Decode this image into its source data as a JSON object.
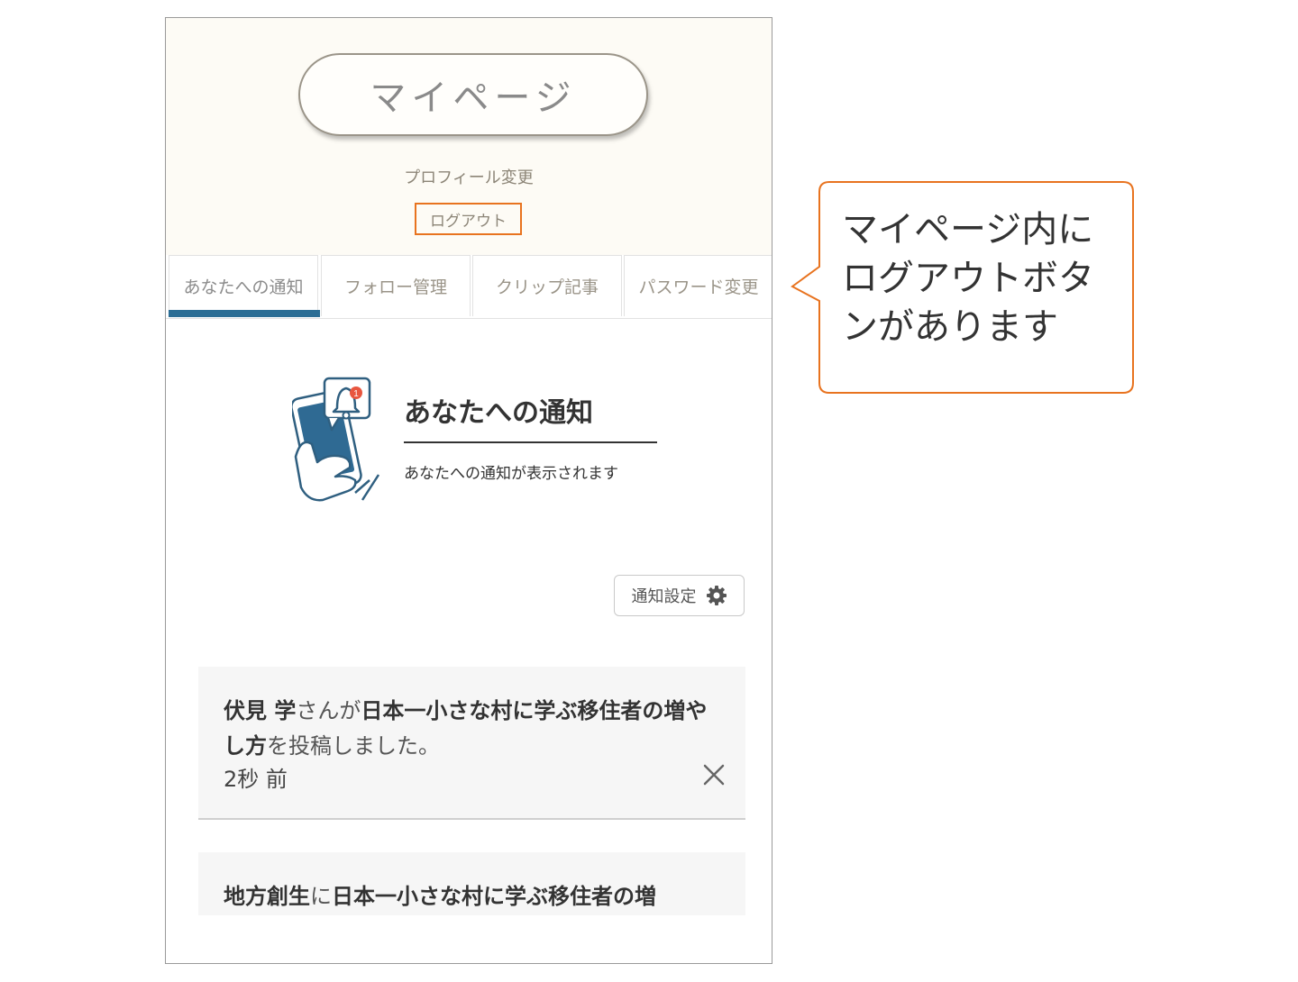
{
  "header": {
    "title": "マイページ",
    "profile_link": "プロフィール変更",
    "logout_link": "ログアウト"
  },
  "tabs": [
    {
      "label": "あなたへの通知",
      "active": true
    },
    {
      "label": "フォロー管理"
    },
    {
      "label": "クリップ記事"
    },
    {
      "label": "パスワード変更"
    }
  ],
  "notice": {
    "title": "あなたへの通知",
    "subtitle": "あなたへの通知が表示されます",
    "badge_count": "1"
  },
  "settings_button": {
    "label": "通知設定",
    "icon": "gear-icon"
  },
  "notifications": [
    {
      "user": "伏見 学",
      "verb": "さんが",
      "article": "日本一小さな村に学ぶ移住者の増やし方",
      "suffix": "を投稿しました。",
      "time": "2秒 前"
    },
    {
      "user": "地方創生",
      "verb": "に",
      "article": "日本一小さな村に学ぶ移住者の増"
    }
  ],
  "callout": {
    "line1": "マイページ内に",
    "line2": "ログアウトボタ",
    "line3": "ンがあります"
  },
  "colors": {
    "accent": "#e8731f",
    "tab_underline": "#2c6e95",
    "header_bg": "#fdfbf5",
    "phone_blue": "#2f6a93"
  }
}
